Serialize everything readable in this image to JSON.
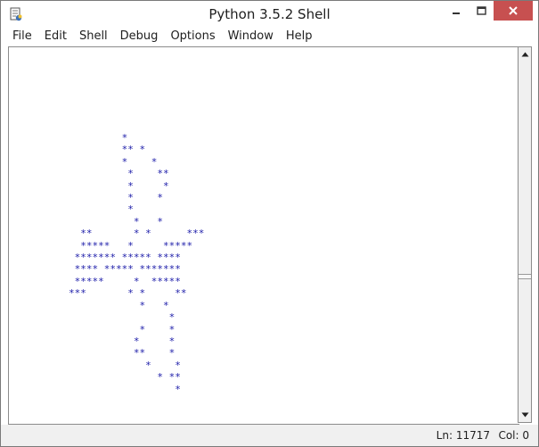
{
  "window": {
    "title": "Python 3.5.2 Shell"
  },
  "menu": {
    "items": [
      {
        "label": "File"
      },
      {
        "label": "Edit"
      },
      {
        "label": "Shell"
      },
      {
        "label": "Debug"
      },
      {
        "label": "Options"
      },
      {
        "label": "Window"
      },
      {
        "label": "Help"
      }
    ]
  },
  "shell": {
    "output": "         *\n         ** *\n         *    *\n          *    **\n          *     *\n          *    *\n          *\n           *   *\n  **       * *      ***\n  *****   *     *****\n ******* ***** ****\n **** ***** *******\n *****     *  *****\n***       * *     **\n            *   *\n                 *\n            *    *\n           *     *\n           **    *\n             *    *\n               * **\n                  *",
    "text_color": "#1a1aa8"
  },
  "status": {
    "line": "Ln: 11717",
    "col": "Col: 0"
  },
  "icons": {
    "app": "idle-icon",
    "minimize": "minimize-icon",
    "maximize": "maximize-icon",
    "close": "close-icon",
    "scroll_up": "scroll-up-icon",
    "scroll_down": "scroll-down-icon"
  },
  "colors": {
    "close_button": "#c75050",
    "window_border": "#7a7a7a"
  }
}
